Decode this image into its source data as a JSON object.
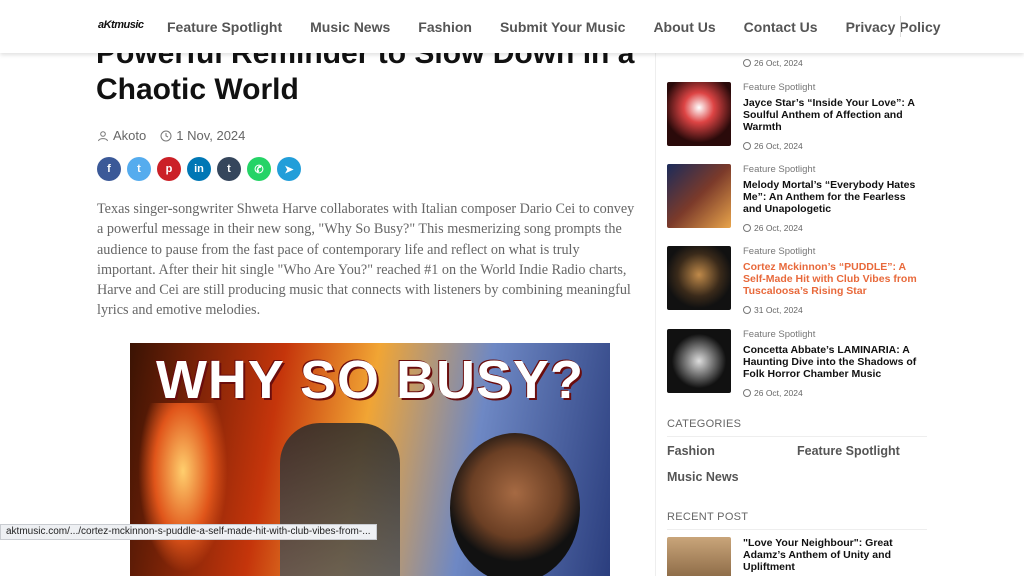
{
  "header": {
    "logo": "aKtmusic",
    "nav": [
      "Feature Spotlight",
      "Music News",
      "Fashion",
      "Submit Your Music",
      "About Us",
      "Contact Us",
      "Privacy Policy"
    ]
  },
  "article": {
    "title": "Powerful Reminder to Slow Down in a Chaotic World",
    "author": "Akoto",
    "date": "1 Nov, 2024",
    "share_icons": [
      "facebook-icon",
      "twitter-icon",
      "pinterest-icon",
      "linkedin-icon",
      "tumblr-icon",
      "whatsapp-icon",
      "telegram-icon"
    ],
    "body": "Texas singer-songwriter Shweta Harve collaborates with Italian composer Dario Cei to convey a powerful message in their new song, \"Why So Busy?\" This mesmerizing song prompts the audience to pause from the fast pace of contemporary life and reflect on what is truly important. After their hit single \"Who Are You?\" reached #1 on the World Indie Radio charts, Harve and Cei are still producing music that connects with listeners by combining meaningful lyrics and emotive melodies.",
    "hero_text": "WHY SO BUSY?"
  },
  "status_bar": "aktmusic.com/.../cortez-mckinnon-s-puddle-a-self-made-hit-with-club-vibes-from-...",
  "sidebar": {
    "top_date": "26 Oct, 2024",
    "posts": [
      {
        "category": "Feature Spotlight",
        "title": "Jayce Star’s “Inside Your Love”: A Soulful Anthem of Affection and Warmth",
        "date": "26 Oct, 2024"
      },
      {
        "category": "Feature Spotlight",
        "title": "Melody Mortal’s “Everybody Hates Me”: An Anthem for the Fearless and Unapologetic",
        "date": "26 Oct, 2024"
      },
      {
        "category": "Feature Spotlight",
        "title": "Cortez Mckinnon’s “PUDDLE”: A Self-Made Hit with Club Vibes from Tuscaloosa’s Rising Star",
        "date": "31 Oct, 2024"
      },
      {
        "category": "Feature Spotlight",
        "title": "Concetta Abbate’s LAMINARIA: A Haunting Dive into the Shadows of Folk Horror Chamber Music",
        "date": "26 Oct, 2024"
      }
    ],
    "categories_heading": "CATEGORIES",
    "categories": [
      "Fashion",
      "Feature Spotlight",
      "Music News"
    ],
    "recent_heading": "RECENT POST",
    "recent_title": "\"Love Your Neighbour\": Great Adamz’s Anthem of Unity and Upliftment"
  },
  "colors": {
    "accent": "#e8693b",
    "facebook": "#3b5998",
    "twitter": "#55acee",
    "pinterest": "#cb2027",
    "linkedin": "#0077b5",
    "tumblr": "#35465c",
    "whatsapp": "#25d366",
    "telegram": "#229ed9"
  }
}
